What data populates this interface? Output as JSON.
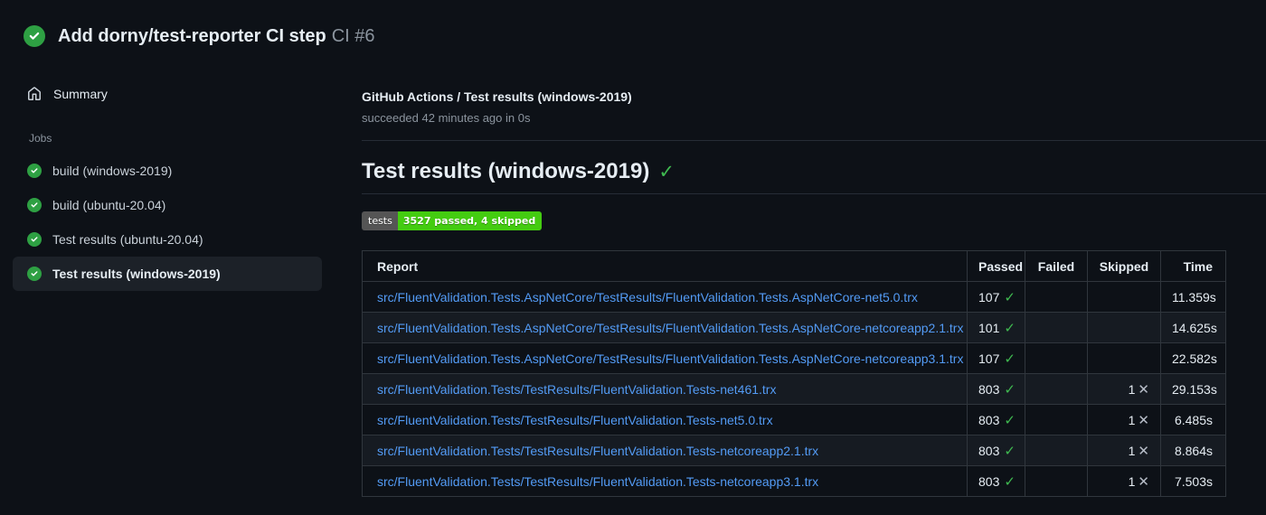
{
  "header": {
    "title": "Add dorny/test-reporter CI step",
    "run_number": "CI #6",
    "status_icon": "check-circle-success"
  },
  "sidebar": {
    "summary_label": "Summary",
    "summary_icon": "home-icon",
    "jobs_label": "Jobs",
    "jobs": [
      {
        "label": "build (windows-2019)",
        "status": "success",
        "selected": false
      },
      {
        "label": "build (ubuntu-20.04)",
        "status": "success",
        "selected": false
      },
      {
        "label": "Test results (ubuntu-20.04)",
        "status": "success",
        "selected": false
      },
      {
        "label": "Test results (windows-2019)",
        "status": "success",
        "selected": true
      }
    ]
  },
  "main": {
    "breadcrumb": "GitHub Actions / Test results (windows-2019)",
    "status_line": "succeeded 42 minutes ago in 0s",
    "heading": "Test results (windows-2019)",
    "heading_check": "✓",
    "badge": {
      "label": "tests",
      "value": "3527 passed, 4 skipped",
      "label_bg": "#555555",
      "value_bg": "#44cc11"
    },
    "table": {
      "columns": [
        "Report",
        "Passed",
        "Failed",
        "Skipped",
        "Time"
      ],
      "passed_mark": "✓",
      "skipped_mark": "✕",
      "rows": [
        {
          "report": "src/FluentValidation.Tests.AspNetCore/TestResults/FluentValidation.Tests.AspNetCore-net5.0.trx",
          "passed": "107",
          "failed": "",
          "skipped": "",
          "time": "11.359s"
        },
        {
          "report": "src/FluentValidation.Tests.AspNetCore/TestResults/FluentValidation.Tests.AspNetCore-netcoreapp2.1.trx",
          "passed": "101",
          "failed": "",
          "skipped": "",
          "time": "14.625s"
        },
        {
          "report": "src/FluentValidation.Tests.AspNetCore/TestResults/FluentValidation.Tests.AspNetCore-netcoreapp3.1.trx",
          "passed": "107",
          "failed": "",
          "skipped": "",
          "time": "22.582s"
        },
        {
          "report": "src/FluentValidation.Tests/TestResults/FluentValidation.Tests-net461.trx",
          "passed": "803",
          "failed": "",
          "skipped": "1",
          "time": "29.153s"
        },
        {
          "report": "src/FluentValidation.Tests/TestResults/FluentValidation.Tests-net5.0.trx",
          "passed": "803",
          "failed": "",
          "skipped": "1",
          "time": "6.485s"
        },
        {
          "report": "src/FluentValidation.Tests/TestResults/FluentValidation.Tests-netcoreapp2.1.trx",
          "passed": "803",
          "failed": "",
          "skipped": "1",
          "time": "8.864s"
        },
        {
          "report": "src/FluentValidation.Tests/TestResults/FluentValidation.Tests-netcoreapp3.1.trx",
          "passed": "803",
          "failed": "",
          "skipped": "1",
          "time": "7.503s"
        }
      ]
    }
  },
  "colors": {
    "page_bg": "#0d1117",
    "row_alt_bg": "#161b22",
    "table_border": "#30363d",
    "success_green": "#2ea043",
    "check_green": "#3fb950",
    "link_blue": "#539bf5",
    "muted_text": "#8b949e",
    "selected_item_bg": "#1c2128"
  }
}
